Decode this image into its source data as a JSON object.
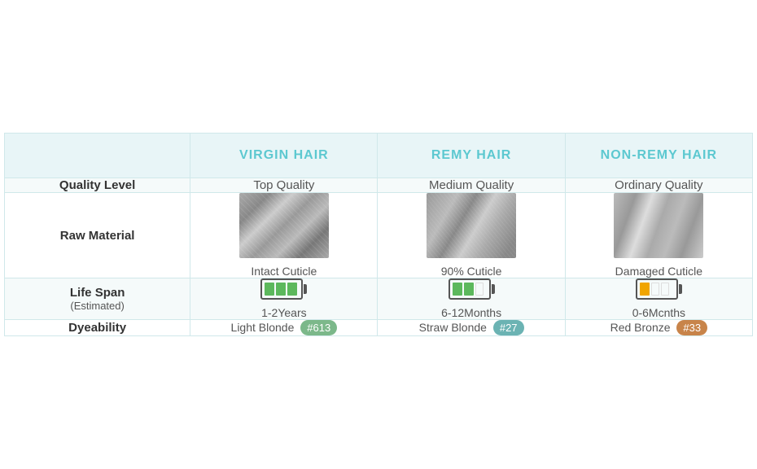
{
  "table": {
    "headers": {
      "empty": "",
      "col1": "VIRGIN HAIR",
      "col2": "REMY HAIR",
      "col3": "NON-REMY HAIR"
    },
    "rows": {
      "quality": {
        "label": "Quality Level",
        "col1": "Top Quality",
        "col2": "Medium Quality",
        "col3": "Ordinary Quality"
      },
      "material": {
        "label": "Raw Material",
        "col1_cuticle": "Intact Cuticle",
        "col2_cuticle": "90% Cuticle",
        "col3_cuticle": "Damaged Cuticle"
      },
      "lifespan": {
        "label": "Life Span",
        "sublabel": "(Estimated)",
        "col1": "1-2Years",
        "col2": "6-12Months",
        "col3": "0-6Mcnths"
      },
      "dyeability": {
        "label": "Dyeability",
        "col1_text": "Light Blonde",
        "col1_badge": "#613",
        "col2_text": "Straw Blonde",
        "col2_badge": "#27",
        "col3_text": "Red Bronze",
        "col3_badge": "#33"
      }
    }
  }
}
